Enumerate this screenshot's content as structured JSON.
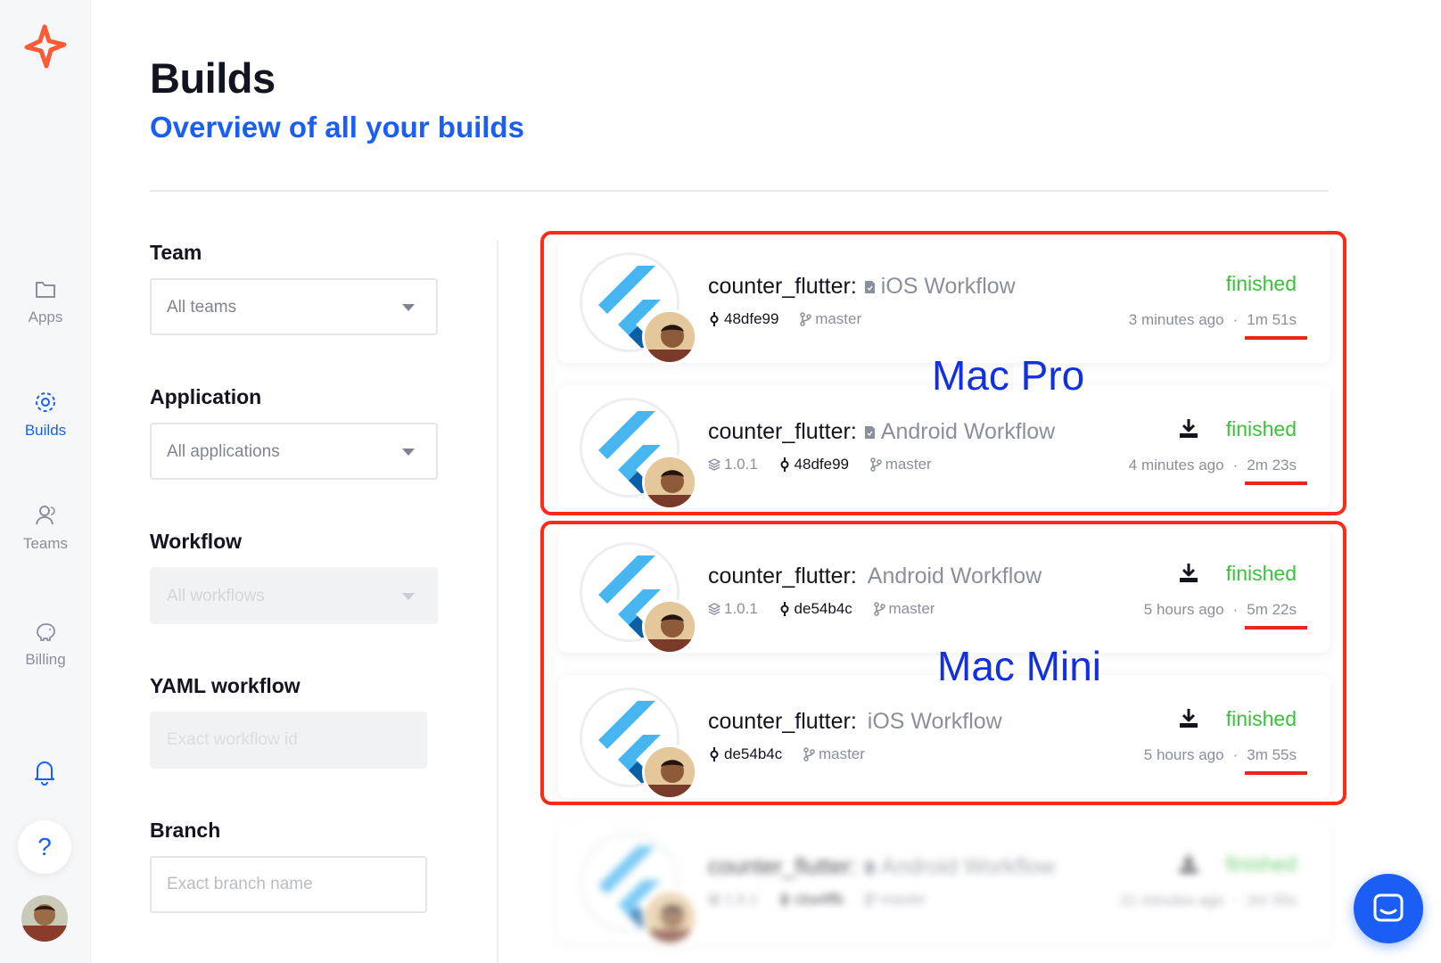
{
  "sidebar": {
    "items": [
      {
        "label": "Apps",
        "icon": "folder-icon"
      },
      {
        "label": "Builds",
        "icon": "builds-gear-icon"
      },
      {
        "label": "Teams",
        "icon": "user-icon"
      },
      {
        "label": "Billing",
        "icon": "piggy-bank-icon"
      }
    ],
    "help_label": "?"
  },
  "header": {
    "title": "Builds",
    "subtitle": "Overview of all your builds"
  },
  "filters": {
    "team": {
      "label": "Team",
      "value": "All teams"
    },
    "application": {
      "label": "Application",
      "value": "All applications"
    },
    "workflow": {
      "label": "Workflow",
      "value": "All workflows"
    },
    "yaml": {
      "label": "YAML workflow",
      "placeholder": "Exact workflow id"
    },
    "branch": {
      "label": "Branch",
      "placeholder": "Exact branch name"
    }
  },
  "builds": [
    {
      "app": "counter_flutter:",
      "workflow": "iOS Workflow",
      "version": "",
      "commit": "48dfe99",
      "branch": "master",
      "status": "finished",
      "ago": "3 minutes ago",
      "duration": "1m 51s",
      "download": false
    },
    {
      "app": "counter_flutter:",
      "workflow": "Android Workflow",
      "version": "1.0.1",
      "commit": "48dfe99",
      "branch": "master",
      "status": "finished",
      "ago": "4 minutes ago",
      "duration": "2m 23s",
      "download": true
    },
    {
      "app": "counter_flutter:",
      "workflow": "Android Workflow",
      "version": "1.0.1",
      "commit": "de54b4c",
      "branch": "master",
      "status": "finished",
      "ago": "5 hours ago",
      "duration": "5m 22s",
      "download": true
    },
    {
      "app": "counter_flutter:",
      "workflow": "iOS Workflow",
      "version": "",
      "commit": "de54b4c",
      "branch": "master",
      "status": "finished",
      "ago": "5 hours ago",
      "duration": "3m 55s",
      "download": true
    },
    {
      "app": "counter_flutter:",
      "workflow": "Android Workflow",
      "version": "1.0.1",
      "commit": "cba4ffb",
      "branch": "master",
      "status": "finished",
      "ago": "21 minutes ago",
      "duration": "2m 55s",
      "download": true
    }
  ],
  "annotations": {
    "group1": "Mac Pro",
    "group2": "Mac Mini"
  },
  "colors": {
    "accent": "#1a5ef5",
    "status_finished": "#39c23a",
    "annotation_red": "#ff2a1a",
    "annotation_blue": "#1330e0"
  }
}
